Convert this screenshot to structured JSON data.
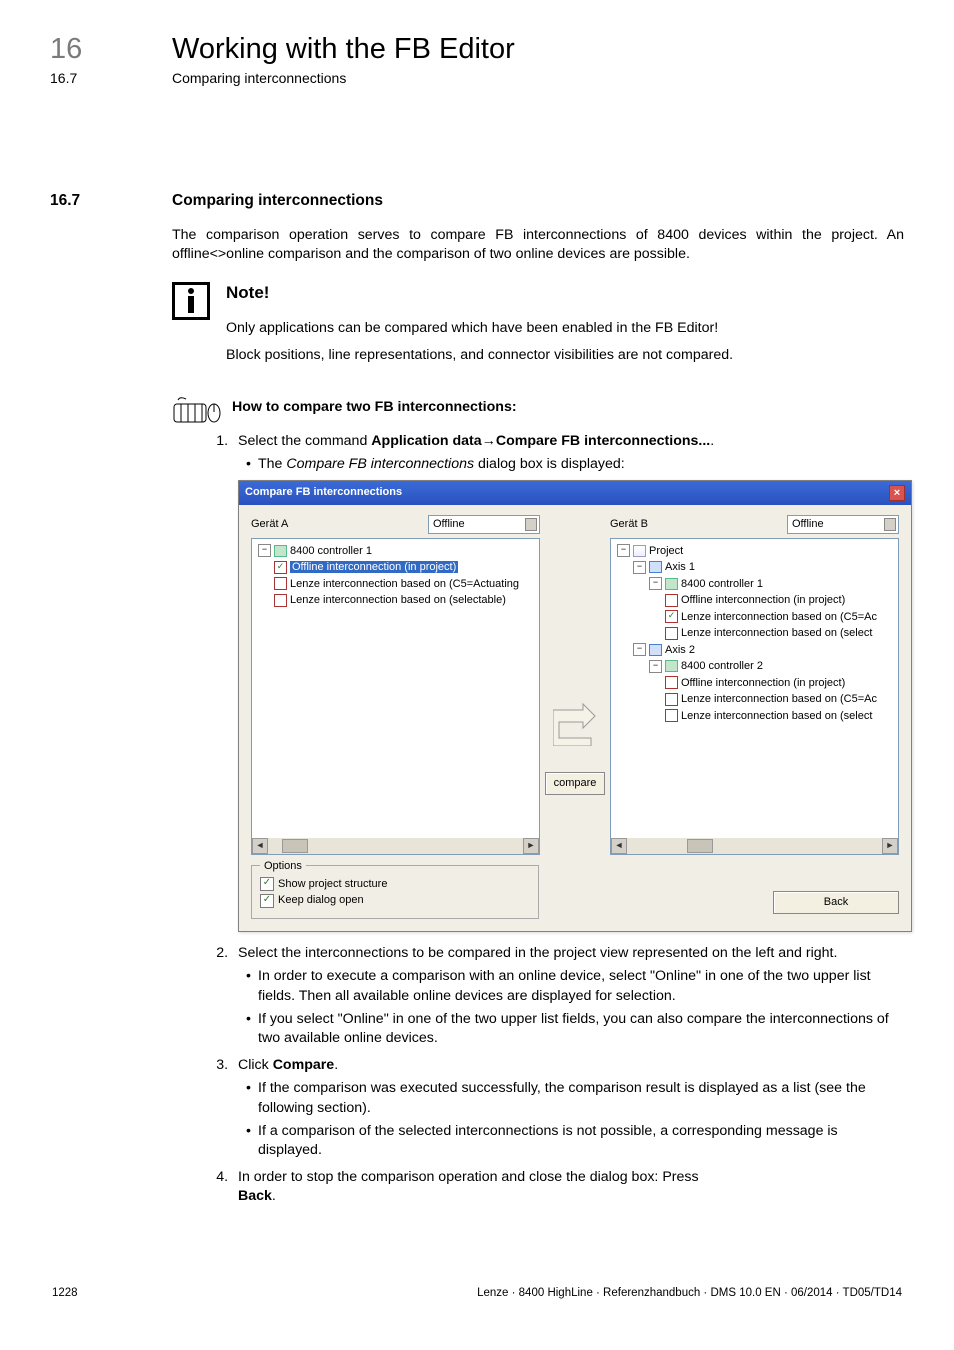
{
  "header": {
    "chapterNum": "16",
    "chapterTitle": "Working with the FB Editor",
    "subNum": "16.7",
    "subTitle": "Comparing interconnections"
  },
  "rule": "_ _ _ _ _ _ _ _ _ _ _ _ _ _ _ _ _ _ _ _ _ _ _ _ _ _ _ _ _ _ _ _ _ _ _ _ _ _ _ _ _ _ _ _ _ _ _ _ _ _ _ _ _ _ _ _ _ _ _ _ _ _ _ _",
  "section": {
    "num": "16.7",
    "title": "Comparing interconnections",
    "intro": "The comparison operation serves to compare FB interconnections of 8400 devices within the project. An offline<>online comparison and the comparison of two online devices are possible."
  },
  "note": {
    "heading": "Note!",
    "lines": [
      "Only applications can be compared which have been enabled in the FB Editor!",
      "Block positions, line representations, and connector visibilities are not compared."
    ]
  },
  "procedure": {
    "title": "How to compare two FB interconnections:",
    "step1_prefix": "Select the command ",
    "step1_cmd1": "Application data",
    "step1_cmd2": "Compare FB interconnections...",
    "step1_suffix": ".",
    "step1_sub_prefix": "The ",
    "step1_sub_italic": "Compare FB interconnections",
    "step1_sub_suffix": " dialog box is displayed:",
    "step2": "Select the interconnections to be compared in the project view represented on the left and right.",
    "step2_subs": [
      "In order to execute a comparison with an online device, select \"Online\" in one of the two upper list fields. Then all available online devices are displayed for selection.",
      "If you select \"Online\" in one of the two upper list fields, you can also compare the interconnections of two available online devices."
    ],
    "step3_prefix": "Click ",
    "step3_bold": "Compare",
    "step3_suffix": ".",
    "step3_subs": [
      "If the comparison was executed successfully, the comparison result is displayed as a list (see the following section).",
      "If a comparison of the selected interconnections is not possible, a corresponding message is displayed."
    ],
    "step4_prefix": "In order to stop the comparison operation and close the dialog box: Press ",
    "step4_bold": "Back",
    "step4_suffix": "."
  },
  "dialog": {
    "title": "Compare FB interconnections",
    "leftLabel": "Gerät A",
    "rightLabel": "Gerät B",
    "selectValue": "Offline",
    "leftTree": {
      "root": "8400 controller 1",
      "items": [
        "Offline interconnection (in project)",
        "Lenze interconnection based on (C5=Actuating",
        "Lenze interconnection based on (selectable)"
      ]
    },
    "rightTree": {
      "root": "Project",
      "axes": [
        {
          "name": "Axis 1",
          "ctrl": "8400 controller 1",
          "items": [
            "Offline interconnection (in project)",
            "Lenze interconnection based on (C5=Ac",
            "Lenze interconnection based on (select"
          ]
        },
        {
          "name": "Axis 2",
          "ctrl": "8400 controller 2",
          "items": [
            "Offline interconnection (in project)",
            "Lenze interconnection based on (C5=Ac",
            "Lenze interconnection based on (select"
          ]
        }
      ]
    },
    "compareBtn": "compare",
    "options": {
      "legend": "Options",
      "show": "Show project structure",
      "keep": "Keep dialog open"
    },
    "backBtn": "Back"
  },
  "footer": {
    "pageNum": "1228",
    "meta": "Lenze · 8400 HighLine · Referenzhandbuch · DMS 10.0 EN · 06/2014 · TD05/TD14"
  }
}
